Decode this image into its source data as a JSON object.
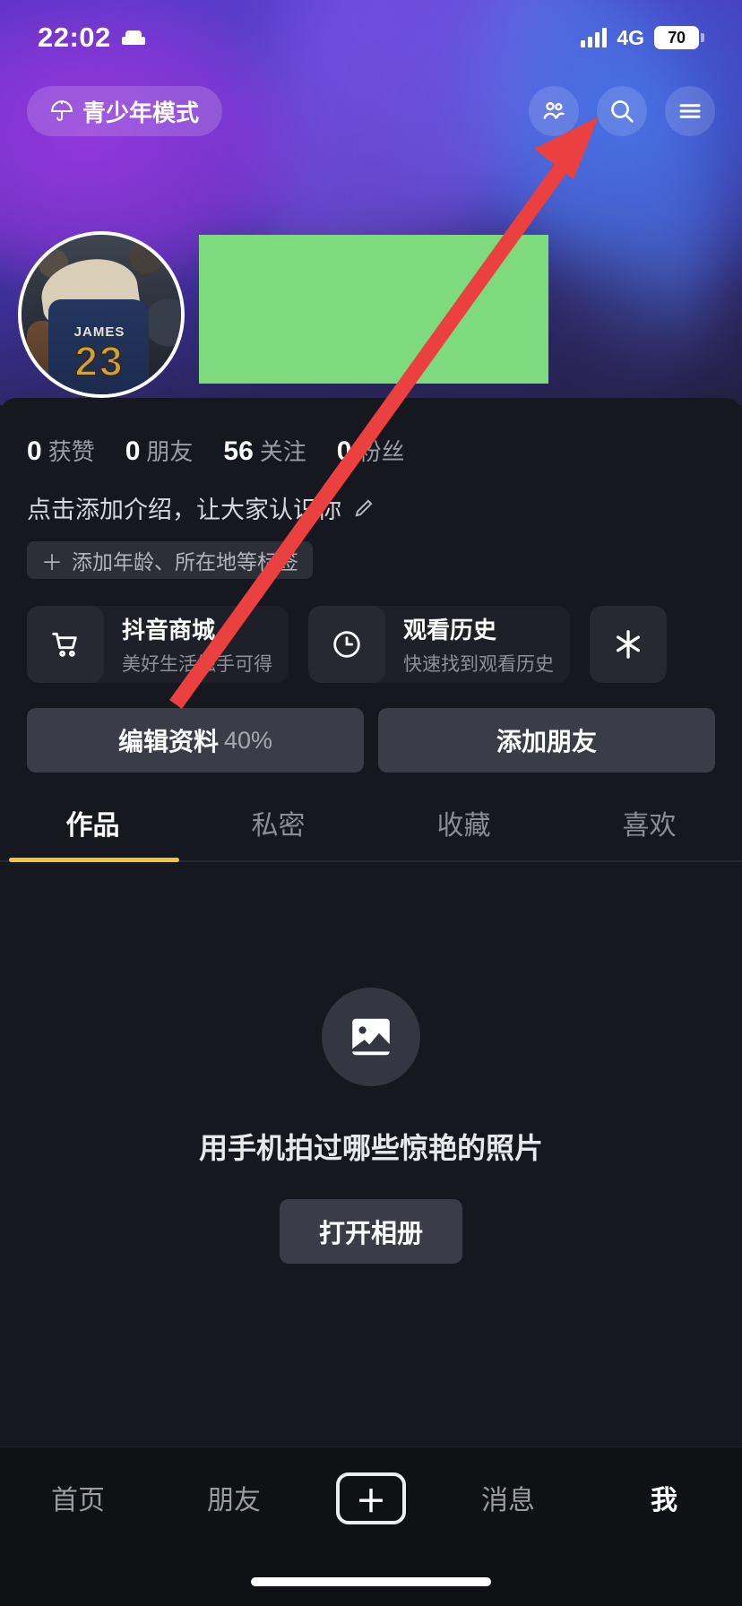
{
  "status_bar": {
    "time": "22:02",
    "sleep_icon": "bed-icon",
    "network": "4G",
    "battery": "70"
  },
  "toolbar": {
    "teen_mode_label": "青少年模式",
    "teen_mode_icon": "umbrella-icon",
    "friends_icon": "two-people-icon",
    "search_icon": "search-icon",
    "menu_icon": "hamburger-menu-icon"
  },
  "profile": {
    "avatar_alt": "JAMES",
    "avatar_number": "23",
    "name_redacted": true,
    "stats": [
      {
        "value": "0",
        "label": "获赞"
      },
      {
        "value": "0",
        "label": "朋友"
      },
      {
        "value": "56",
        "label": "关注"
      },
      {
        "value": "0",
        "label": "粉丝"
      }
    ],
    "bio_placeholder": "点击添加介绍，让大家认识你",
    "bio_edit_icon": "pencil-icon",
    "tag_add_label": "添加年龄、所在地等标签",
    "tag_plus": "＋"
  },
  "shortcut_cards": [
    {
      "title": "抖音商城",
      "subtitle": "美好生活触手可得",
      "icon": "shopping-cart-icon"
    },
    {
      "title": "观看历史",
      "subtitle": "快速找到观看历史",
      "icon": "clock-icon"
    },
    {
      "title": "",
      "subtitle": "",
      "icon": "asterisk-icon"
    }
  ],
  "actions": {
    "edit_profile_label": "编辑资料",
    "edit_profile_percent": "40%",
    "add_friend_label": "添加朋友"
  },
  "tabs": [
    {
      "label": "作品",
      "active": true
    },
    {
      "label": "私密",
      "active": false
    },
    {
      "label": "收藏",
      "active": false
    },
    {
      "label": "喜欢",
      "active": false
    }
  ],
  "empty_state": {
    "icon": "photo-image-icon",
    "message": "用手机拍过哪些惊艳的照片",
    "button_label": "打开相册"
  },
  "bottom_nav": [
    {
      "label": "首页",
      "active": false
    },
    {
      "label": "朋友",
      "active": false
    },
    {
      "label": "＋",
      "active": false
    },
    {
      "label": "消息",
      "active": false
    },
    {
      "label": "我",
      "active": true
    }
  ],
  "colors": {
    "accent_yellow": "#f2c33c",
    "annotation_red": "#ea4040",
    "redaction_green": "#7ddb7d",
    "sheet_bg": "#16181f"
  }
}
